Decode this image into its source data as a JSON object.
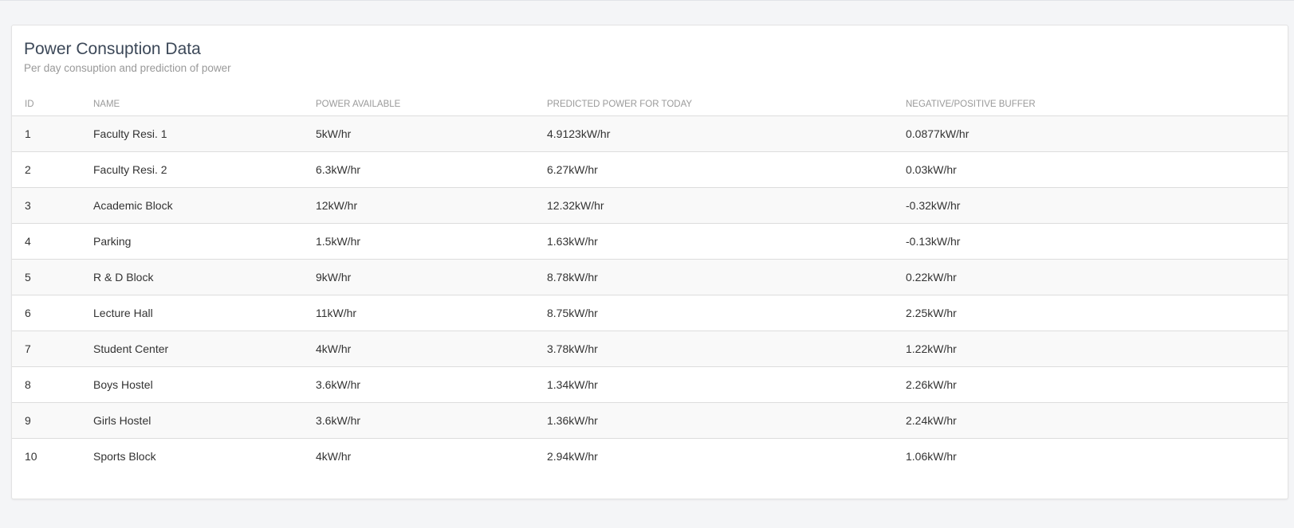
{
  "card": {
    "title": "Power Consuption Data",
    "subtitle": "Per day consuption and prediction of power"
  },
  "table": {
    "headers": [
      "ID",
      "NAME",
      "POWER AVAILABLE",
      "PREDICTED POWER FOR TODAY",
      "NEGATIVE/POSITIVE BUFFER"
    ],
    "rows": [
      {
        "id": "1",
        "name": "Faculty Resi. 1",
        "available": "5kW/hr",
        "predicted": "4.9123kW/hr",
        "buffer": "0.0877kW/hr"
      },
      {
        "id": "2",
        "name": "Faculty Resi. 2",
        "available": "6.3kW/hr",
        "predicted": "6.27kW/hr",
        "buffer": "0.03kW/hr"
      },
      {
        "id": "3",
        "name": "Academic Block",
        "available": "12kW/hr",
        "predicted": "12.32kW/hr",
        "buffer": "-0.32kW/hr"
      },
      {
        "id": "4",
        "name": "Parking",
        "available": "1.5kW/hr",
        "predicted": "1.63kW/hr",
        "buffer": "-0.13kW/hr"
      },
      {
        "id": "5",
        "name": "R & D Block",
        "available": "9kW/hr",
        "predicted": "8.78kW/hr",
        "buffer": "0.22kW/hr"
      },
      {
        "id": "6",
        "name": "Lecture Hall",
        "available": "11kW/hr",
        "predicted": "8.75kW/hr",
        "buffer": "2.25kW/hr"
      },
      {
        "id": "7",
        "name": "Student Center",
        "available": "4kW/hr",
        "predicted": "3.78kW/hr",
        "buffer": "1.22kW/hr"
      },
      {
        "id": "8",
        "name": "Boys Hostel",
        "available": "3.6kW/hr",
        "predicted": "1.34kW/hr",
        "buffer": "2.26kW/hr"
      },
      {
        "id": "9",
        "name": "Girls Hostel",
        "available": "3.6kW/hr",
        "predicted": "1.36kW/hr",
        "buffer": "2.24kW/hr"
      },
      {
        "id": "10",
        "name": "Sports Block",
        "available": "4kW/hr",
        "predicted": "2.94kW/hr",
        "buffer": "1.06kW/hr"
      }
    ]
  }
}
